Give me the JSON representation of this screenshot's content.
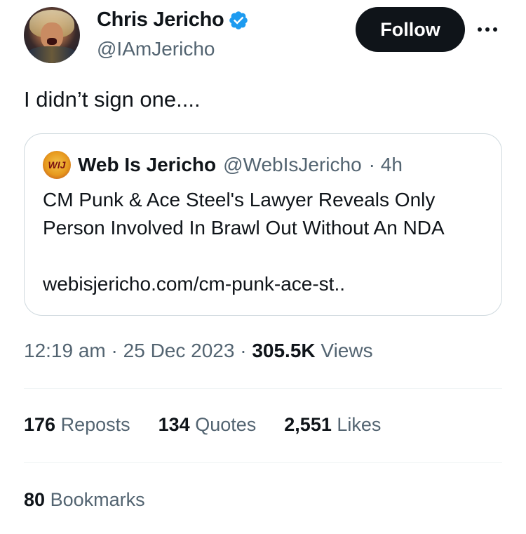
{
  "author": {
    "display_name": "Chris Jericho",
    "handle": "@IAmJericho",
    "verified_color": "#1d9bf0"
  },
  "actions": {
    "follow_label": "Follow"
  },
  "tweet": {
    "text": "I didn’t sign one...."
  },
  "quote": {
    "display_name": "Web Is Jericho",
    "handle": "@WebIsJericho",
    "time": "· 4h",
    "text": "CM Punk & Ace Steel's Lawyer Reveals Only Person Involved In Brawl Out Without An NDA",
    "link": "webisjericho.com/cm-punk-ace-st..",
    "avatar_text": "WIJ"
  },
  "meta": {
    "time": "12:19 am",
    "date": "25 Dec 2023",
    "views_count": "305.5K",
    "views_label": "Views"
  },
  "stats": {
    "reposts_count": "176",
    "reposts_label": "Reposts",
    "quotes_count": "134",
    "quotes_label": "Quotes",
    "likes_count": "2,551",
    "likes_label": "Likes",
    "bookmarks_count": "80",
    "bookmarks_label": "Bookmarks"
  }
}
